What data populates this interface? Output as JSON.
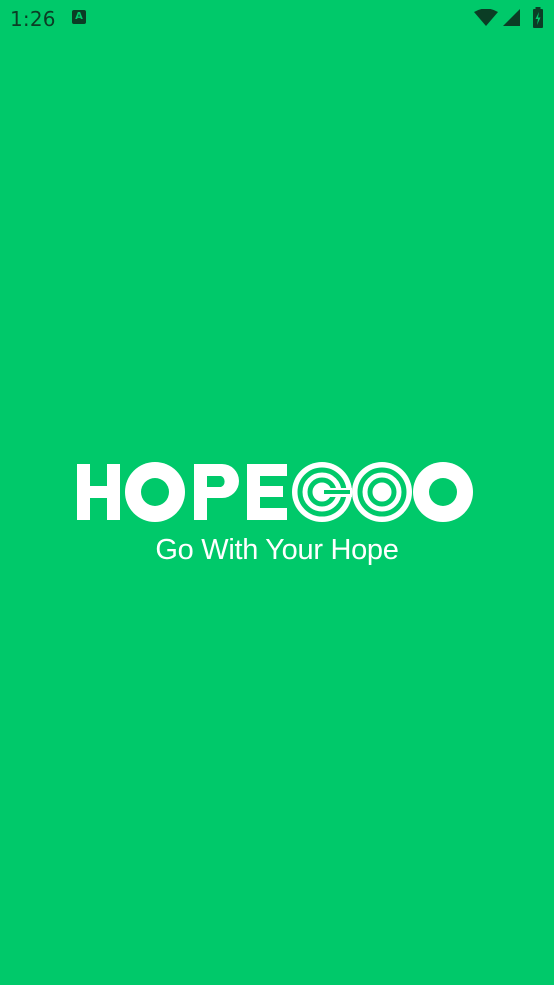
{
  "status_bar": {
    "time": "1:26",
    "notification_icon": "a-letter-icon",
    "notification_glyph": "A",
    "wifi_icon": "wifi-icon",
    "signal_icon": "cell-signal-icon",
    "battery_icon": "battery-charging-icon"
  },
  "brand": {
    "logo_text": "HOPEGOO",
    "tagline": "Go With Your Hope"
  },
  "colors": {
    "background": "#00C96A",
    "foreground": "#FFFFFF",
    "status_icons": "#0B3D25"
  }
}
